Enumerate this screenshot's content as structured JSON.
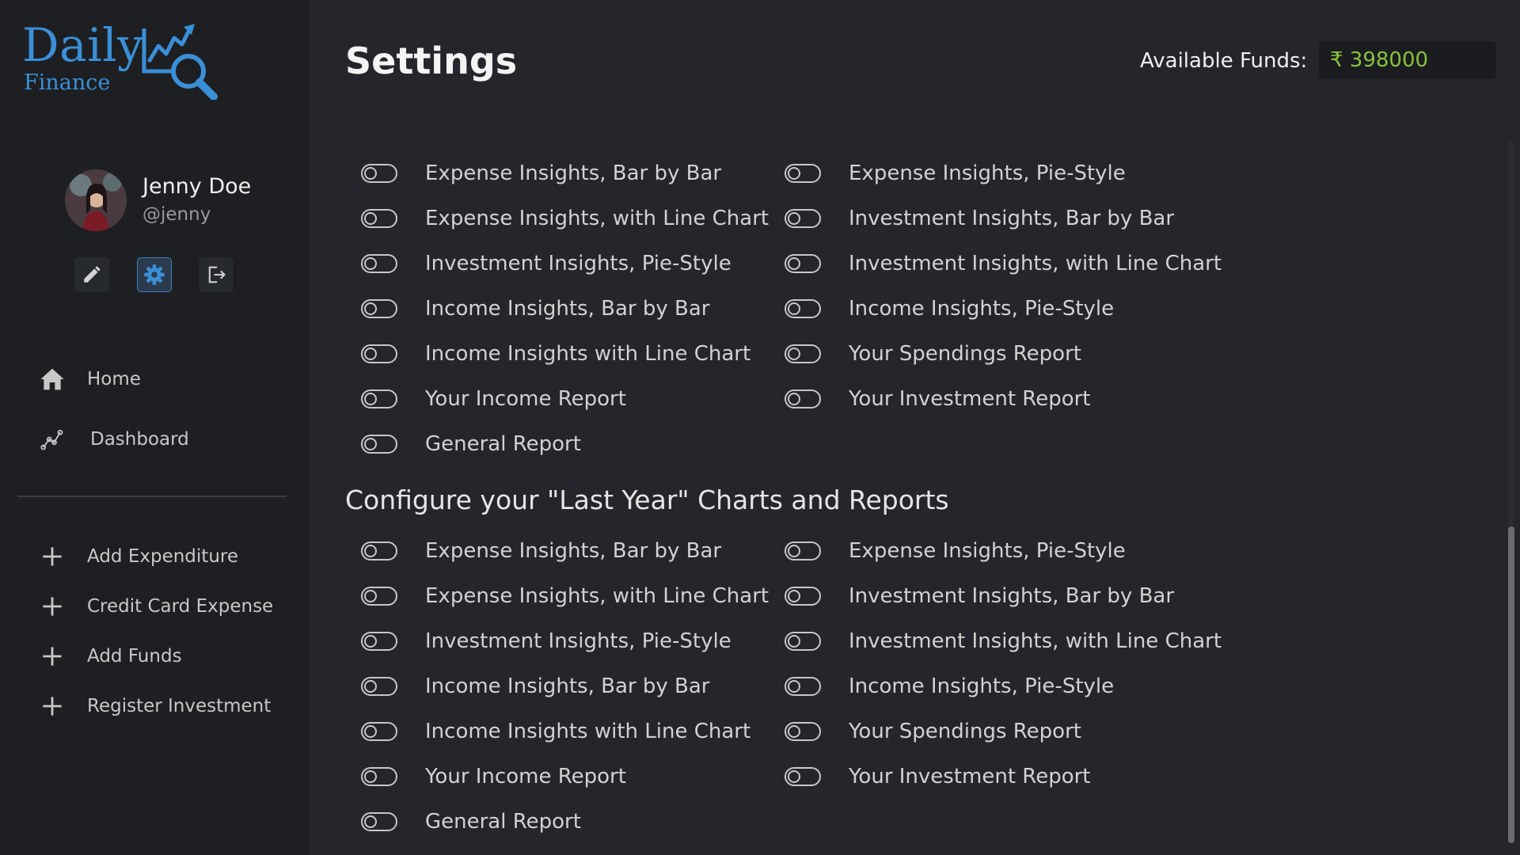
{
  "logo": {
    "word": "Daily",
    "sub": "Finance",
    "brand_color": "#3a8fd6"
  },
  "profile": {
    "name": "Jenny Doe",
    "handle": "@jenny"
  },
  "profile_actions": [
    {
      "id": "edit",
      "icon": "pencil-icon"
    },
    {
      "id": "settings",
      "icon": "gear-icon",
      "active": true
    },
    {
      "id": "logout",
      "icon": "logout-icon"
    }
  ],
  "nav": {
    "home": "Home",
    "dashboard": "Dashboard",
    "add_expenditure": "Add Expenditure",
    "credit_card_expense": "Credit Card Expense",
    "add_funds": "Add Funds",
    "register_investment": "Register Investment"
  },
  "header": {
    "title": "Settings",
    "funds_label": "Available Funds:",
    "funds_value": "₹ 398000",
    "funds_color": "#8ac13a"
  },
  "sections": [
    {
      "title": "",
      "options": [
        {
          "label": "Expense Insights, Bar by Bar",
          "enabled": false
        },
        {
          "label": "Expense Insights, Pie-Style",
          "enabled": false
        },
        {
          "label": "Expense Insights, with Line Chart",
          "enabled": false
        },
        {
          "label": "Investment Insights, Bar by Bar",
          "enabled": false
        },
        {
          "label": "Investment Insights, Pie-Style",
          "enabled": false
        },
        {
          "label": "Investment Insights, with Line Chart",
          "enabled": false
        },
        {
          "label": "Income Insights, Bar by Bar",
          "enabled": false
        },
        {
          "label": "Income Insights, Pie-Style",
          "enabled": false
        },
        {
          "label": "Income Insights with Line Chart",
          "enabled": false
        },
        {
          "label": "Your Spendings Report",
          "enabled": false
        },
        {
          "label": "Your Income Report",
          "enabled": false
        },
        {
          "label": "Your Investment Report",
          "enabled": false
        },
        {
          "label": "General Report",
          "enabled": false
        }
      ]
    },
    {
      "title": "Configure your \"Last Year\" Charts and Reports",
      "options": [
        {
          "label": "Expense Insights, Bar by Bar",
          "enabled": false
        },
        {
          "label": "Expense Insights, Pie-Style",
          "enabled": false
        },
        {
          "label": "Expense Insights, with Line Chart",
          "enabled": false
        },
        {
          "label": "Investment Insights, Bar by Bar",
          "enabled": false
        },
        {
          "label": "Investment Insights, Pie-Style",
          "enabled": false
        },
        {
          "label": "Investment Insights, with Line Chart",
          "enabled": false
        },
        {
          "label": "Income Insights, Bar by Bar",
          "enabled": false
        },
        {
          "label": "Income Insights, Pie-Style",
          "enabled": false
        },
        {
          "label": "Income Insights with Line Chart",
          "enabled": false
        },
        {
          "label": "Your Spendings Report",
          "enabled": false
        },
        {
          "label": "Your Income Report",
          "enabled": false
        },
        {
          "label": "Your Investment Report",
          "enabled": false
        },
        {
          "label": "General Report",
          "enabled": false
        }
      ]
    }
  ]
}
